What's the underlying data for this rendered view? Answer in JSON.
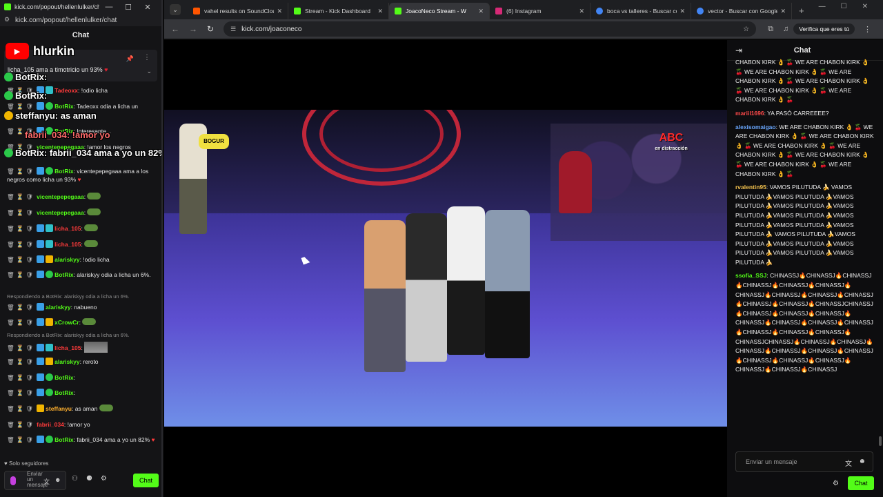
{
  "left_window": {
    "title": "kick.com/popout/hellenlulker/chat...",
    "url": "kick.com/popout/hellenlulker/chat",
    "chat_title": "Chat",
    "yt_name": "hlurkin",
    "pinned_msg": "licha_105 ama a timotricio un 93%",
    "footer_note": "Solo seguidores",
    "input_placeholder": "Enviar un mensaje",
    "chat_button": "Chat"
  },
  "left_overlays": [
    {
      "text": "BotRix:"
    },
    {
      "text": "BotRix:"
    },
    {
      "text": "steffanyu: as aman"
    },
    {
      "text": "fabrii_034: !amor yo"
    },
    {
      "text": "BotRix: fabrii_034 ama a yo un 82%"
    }
  ],
  "left_chat": [
    {
      "user": "Tadeoxx",
      "color": "u-red",
      "text": ": !odio licha"
    },
    {
      "user": "BotRix",
      "color": "u-green",
      "text": ": Tadeoxx odia a licha un"
    },
    {
      "user": "BotRix",
      "color": "u-green",
      "text": ": Interesante..."
    },
    {
      "user": "vicentepepegaaa",
      "color": "u-green",
      "text": ": !amor los negros"
    },
    {
      "user": "BotRix",
      "color": "u-green",
      "text": ": vicentepepegaaa ama a los negros como licha un 93%"
    },
    {
      "user": "vicentepepegaaa",
      "color": "u-green",
      "text": ":"
    },
    {
      "user": "vicentepepegaaa",
      "color": "u-green",
      "text": ":"
    },
    {
      "user": "licha_105",
      "color": "u-red",
      "text": ":"
    },
    {
      "user": "licha_105",
      "color": "u-red",
      "text": ":"
    },
    {
      "user": "alariskyy",
      "color": "u-green",
      "text": ": !odio licha"
    },
    {
      "user": "BotRix",
      "color": "u-green",
      "text": ": alariskyy odia a licha un 6%."
    },
    {
      "user": "alariskyy",
      "color": "u-green",
      "text": ": nabueno"
    },
    {
      "user": "xCrowCr",
      "color": "u-green",
      "text": ":"
    },
    {
      "user": "licha_105",
      "color": "u-red",
      "text": ":"
    },
    {
      "user": "alariskyy",
      "color": "u-green",
      "text": ": reroto"
    },
    {
      "user": "BotRix",
      "color": "u-green",
      "text": ":"
    },
    {
      "user": "BotRix",
      "color": "u-green",
      "text": ":"
    },
    {
      "user": "steffanyu",
      "color": "u-orange",
      "text": ": as aman"
    },
    {
      "user": "fabrii_034",
      "color": "u-red",
      "text": ": !amor yo"
    },
    {
      "user": "BotRix",
      "color": "u-green",
      "text": ": fabrii_034 ama a yo un 82%"
    }
  ],
  "reply_notes": [
    "Respondiendo a BotRix: alariskyy odia a licha un 6%.",
    "Respondiendo a BotRix: alariskyy odia a licha un 6%."
  ],
  "tabs": [
    {
      "label": "vahel results on SoundClou",
      "color": "#ff5500"
    },
    {
      "label": "Stream - Kick Dashboard",
      "color": "#53fc18"
    },
    {
      "label": "JoacoNeco Stream - W",
      "color": "#53fc18",
      "active": true
    },
    {
      "label": "(6) Instagram",
      "color": "#d62976"
    },
    {
      "label": "boca vs talleres - Buscar co",
      "color": "#4285f4"
    },
    {
      "label": "vector - Buscar con Google",
      "color": "#4285f4"
    }
  ],
  "browser": {
    "url": "kick.com/joaconeco",
    "profile_label": "Verifica que eres tú"
  },
  "video_overlays": {
    "logo1": "BOGUR",
    "logo2": "ABC",
    "logo2_sub": "en distracción"
  },
  "right_chat": {
    "title": "Chat",
    "messages": [
      {
        "user": "",
        "color": "",
        "text": "CHABON KIRK 👌 🍒 WE ARE CHABON KIRK 👌 🍒 WE ARE CHABON KIRK 👌 🍒 WE ARE CHABON KIRK 👌 🍒 WE ARE CHABON KIRK 👌 🍒 WE ARE CHABON KIRK 👌 🍒 WE ARE CHABON KIRK 👌 🍒"
      },
      {
        "user": "mariil1696",
        "color": "uc-red",
        "text": ": YA PASÓ CARREEEE?"
      },
      {
        "user": "alexisomaigao",
        "color": "uc-blue",
        "text": ": WE ARE CHABON KIRK 👌 🍒 WE ARE CHABON KIRK 👌 🍒 WE ARE CHABON KIRK 👌 🍒 WE ARE CHABON KIRK 👌 🍒 WE ARE CHABON KIRK 👌 🍒 WE ARE CHABON KIRK 👌 🍒 WE ARE CHABON KIRK 👌 🍒 WE ARE CHABON KIRK 👌 🍒"
      },
      {
        "user": "rvalentin95",
        "color": "uc-yellow",
        "text": ": VAMOS PILUTUDA 🍌 VAMOS PILUTUDA 🍌VAMOS PILUTUDA 🍌VAMOS PILUTUDA 🍌VAMOS PILUTUDA 🍌VAMOS PILUTUDA 🍌VAMOS PILUTUDA 🍌VAMOS PILUTUDA 🍌VAMOS PILUTUDA 🍌VAMOS PILUTUDA 🍌 VAMOS PILUTUDA 🍌VAMOS PILUTUDA 🍌VAMOS PILUTUDA 🍌VAMOS PILUTUDA 🍌VAMOS PILUTUDA 🍌VAMOS PILUTUDA 🍌"
      },
      {
        "user": "ssofia_SSJ",
        "color": "uc-green",
        "text": ": CHINASSJ🔥CHINASSJ🔥CHINASSJ🔥CHINASSJ🔥CHINASSJ🔥CHINASSJ🔥CHINASSJ🔥CHINASSJ🔥CHINASSJ🔥CHINASSJ🔥CHINASSJ🔥CHINASSJ🔥CHINASSJCHINASSJ🔥CHINASSJ🔥CHINASSJ🔥CHINASSJ🔥CHINASSJ🔥CHINASSJ🔥CHINASSJ🔥CHINASSJ🔥CHINASSJ🔥CHINASSJ🔥CHINASSJ🔥CHINASSJCHINASSJ🔥CHINASSJ🔥CHINASSJ🔥CHINASSJ🔥CHINASSJ🔥CHINASSJ🔥CHINASSJ🔥CHINASSJ🔥CHINASSJ🔥CHINASSJ🔥CHINASSJ🔥CHINASSJ🔥CHINASSJ"
      }
    ],
    "input_placeholder": "Enviar un mensaje",
    "send_label": "Chat"
  }
}
